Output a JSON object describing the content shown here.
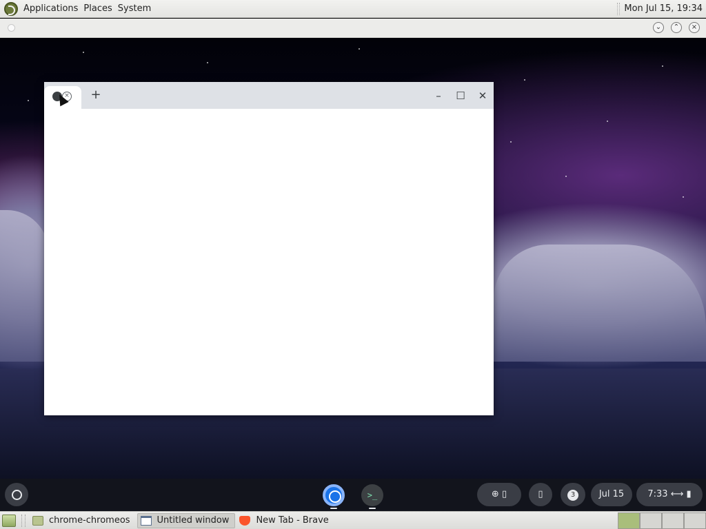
{
  "top_panel": {
    "menu": [
      "Applications",
      "Places",
      "System"
    ],
    "clock": "Mon Jul 15, 19:34"
  },
  "host_window": {
    "buttons": {
      "minimize": "⌄",
      "maximize": "⌃",
      "close": "×"
    }
  },
  "browser": {
    "new_tab": "+",
    "controls": {
      "minimize": "–",
      "maximize": "☐",
      "close": "✕"
    },
    "tab_close": "×"
  },
  "shelf": {
    "notification_count": "3",
    "date": "Jul 15",
    "time": "7:33",
    "apps": [
      "chrome",
      "terminal"
    ],
    "terminal_glyph": ">_"
  },
  "taskbar": {
    "tasks": [
      {
        "label": "chrome-chromeos",
        "icon": "folder-icon"
      },
      {
        "label": "Untitled window",
        "icon": "window-icon"
      },
      {
        "label": "New Tab - Brave",
        "icon": "brave-icon"
      }
    ],
    "workspaces": 4
  }
}
